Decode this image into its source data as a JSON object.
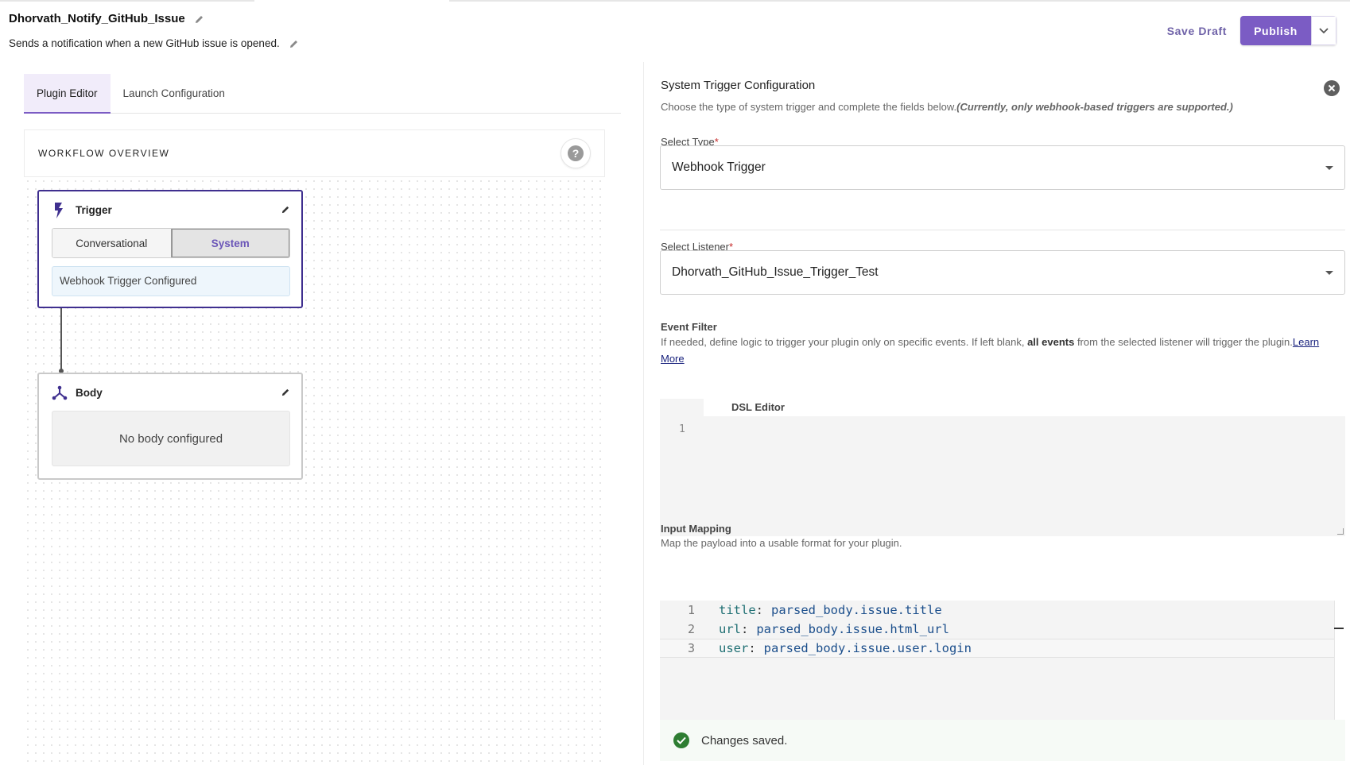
{
  "header": {
    "title": "Dhorvath_Notify_GitHub_Issue",
    "description": "Sends a notification when a new GitHub issue is opened.",
    "save_draft_label": "Save Draft",
    "publish_label": "Publish"
  },
  "left": {
    "tabs": [
      {
        "label": "Plugin Editor",
        "active": true
      },
      {
        "label": "Launch Configuration",
        "active": false
      }
    ],
    "overview_label": "WORKFLOW OVERVIEW",
    "help_glyph": "?",
    "trigger_node": {
      "title": "Trigger",
      "segments": [
        "Conversational",
        "System"
      ],
      "selected_segment": "System",
      "status": "Webhook Trigger Configured"
    },
    "body_node": {
      "title": "Body",
      "empty_text": "No body configured"
    }
  },
  "config": {
    "title": "System Trigger Configuration",
    "subtitle": "Choose the type of system trigger and complete the fields below.",
    "subtitle_note": "(Currently, only webhook-based triggers are supported.)",
    "select_type_label": "Select Type",
    "select_type_value": "Webhook Trigger",
    "select_listener_label": "Select Listener",
    "select_listener_value": "Dhorvath_GitHub_Issue_Trigger_Test",
    "event_filter": {
      "title": "Event Filter",
      "desc_before": "If needed, define logic to trigger your plugin only on specific events. If left blank, ",
      "desc_bold": "all events",
      "desc_after": " from the selected listener will trigger the plugin.",
      "link": "Learn More",
      "editor_label": "DSL Editor",
      "line_numbers": [
        "1"
      ]
    },
    "input_mapping": {
      "title": "Input Mapping",
      "desc": "Map the payload into a usable format for your plugin.",
      "lines": [
        {
          "n": "1",
          "key": "title",
          "value": "parsed_body.issue.title"
        },
        {
          "n": "2",
          "key": "url",
          "value": "parsed_body.issue.html_url"
        },
        {
          "n": "3",
          "key": "user",
          "value": "parsed_body.issue.user.login"
        }
      ]
    },
    "toast": "Changes saved."
  },
  "colors": {
    "accent": "#7b5cc4",
    "trigger_border": "#3f2f8f",
    "success": "#2e7d32"
  }
}
